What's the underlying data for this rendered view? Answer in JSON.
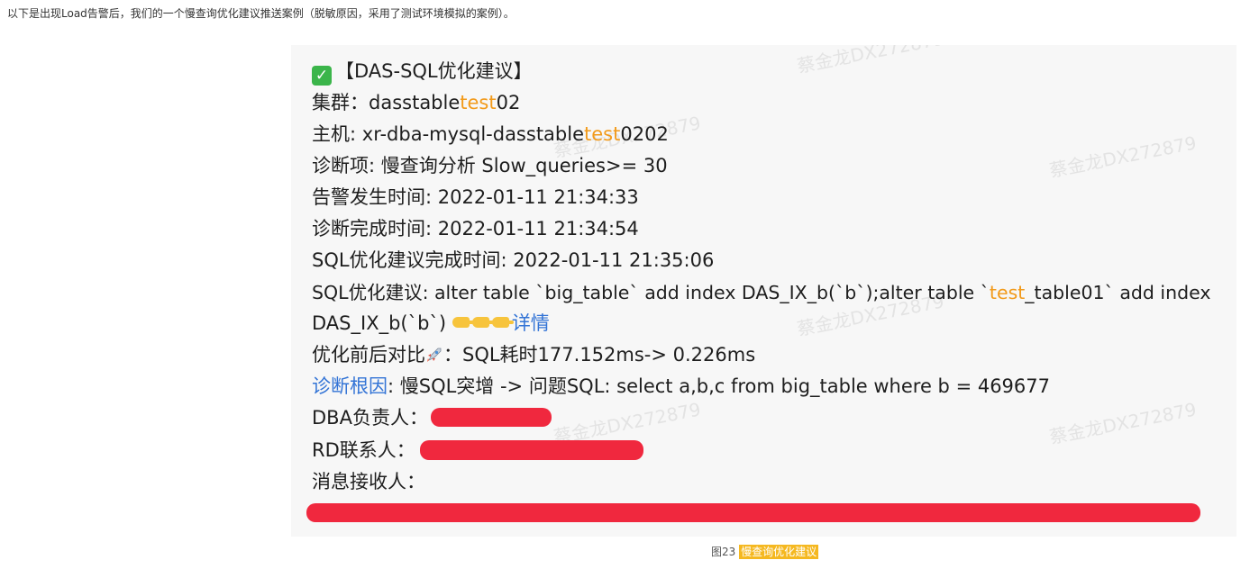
{
  "intro": "以下是出现Load告警后，我们的一个慢查询优化建议推送案例（脱敏原因，采用了测试环境模拟的案例）。",
  "watermark": "蔡金龙DX272879",
  "message": {
    "title": "【DAS-SQL优化建议】",
    "cluster_label": "集群：",
    "cluster_prefix": "dasstable",
    "cluster_hl": "test",
    "cluster_suffix": "02",
    "host_label": "主机: ",
    "host_prefix": "xr-dba-mysql-dasstable",
    "host_hl": "test",
    "host_suffix": "0202",
    "diag_item": "诊断项: 慢查询分析 Slow_queries>= 30",
    "alert_time": "告警发生时间: 2022-01-11 21:34:33",
    "diag_done_time": "诊断完成时间: 2022-01-11 21:34:54",
    "sql_done_time": "SQL优化建议完成时间: 2022-01-11 21:35:06",
    "sql_suggest_prefix": "SQL优化建议: alter table `big_table` add index DAS_IX_b(`b`);alter table `",
    "sql_suggest_hl": "test",
    "sql_suggest_suffix": "_table01` add index",
    "sql_suggest_line2": "DAS_IX_b(`b`)",
    "detail_link": "详情",
    "compare_label": "优化前后对比",
    "compare_value": "：SQL耗时177.152ms-> 0.226ms",
    "root_cause_link": "诊断根因",
    "root_cause_value": ": 慢SQL突增 -> 问题SQL: select a,b,c from big_table where b = 469677",
    "dba_label": "DBA负责人：",
    "rd_label": "RD联系人：",
    "receiver_label": "消息接收人："
  },
  "caption": {
    "prefix": "图23 ",
    "highlight": "慢查询优化建议"
  },
  "colors": {
    "highlight": "#f29a1a",
    "link": "#3374d6",
    "redaction": "#f0283e",
    "card_bg": "#f7f7f7",
    "caption_mark": "#f5b820"
  }
}
